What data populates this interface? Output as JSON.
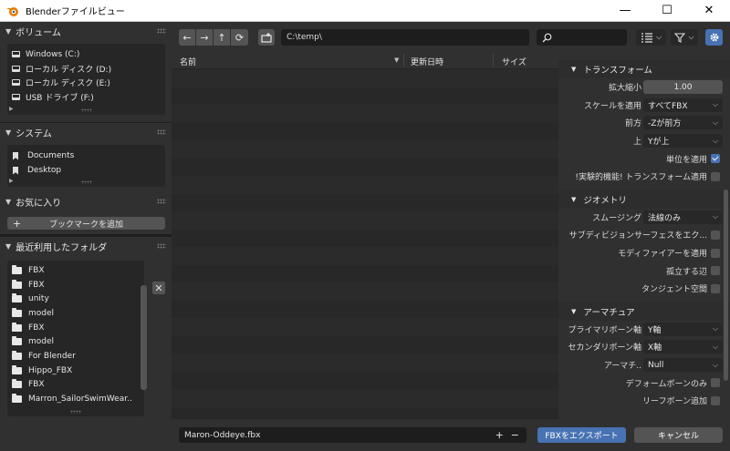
{
  "window": {
    "title": "Blenderファイルビュー",
    "minimize": "—",
    "maximize": "☐",
    "close": "✕"
  },
  "sidebar": {
    "volumes": {
      "title": "ボリューム",
      "items": [
        "Windows (C:)",
        "ローカル ディスク (D:)",
        "ローカル ディスク (E:)",
        "USB ドライブ (F:)"
      ]
    },
    "system": {
      "title": "システム",
      "items": [
        "Documents",
        "Desktop"
      ]
    },
    "favorites": {
      "title": "お気に入り",
      "add_label": "ブックマークを追加"
    },
    "recent": {
      "title": "最近利用したフォルダ",
      "items": [
        "FBX",
        "FBX",
        "unity",
        "model",
        "FBX",
        "model",
        "For Blender",
        "Hippo_FBX",
        "FBX",
        "Marron_SailorSwimWear.."
      ]
    }
  },
  "toolbar": {
    "path": "C:\\temp\\",
    "back": "←",
    "forward": "→",
    "parent": "↑",
    "refresh": "⟳"
  },
  "filelist": {
    "columns": {
      "name": "名前",
      "modified": "更新日時",
      "size": "サイズ"
    }
  },
  "properties": {
    "transform": {
      "title": "トランスフォーム",
      "scale_label": "拡大縮小",
      "scale_value": "1.00",
      "apply_scale_label": "スケールを適用",
      "apply_scale_value": "すべてFBX",
      "forward_label": "前方",
      "forward_value": "-Zが前方",
      "up_label": "上",
      "up_value": "Yが上",
      "apply_unit_label": "単位を適用",
      "apply_unit_checked": true,
      "experimental_label": "!実験的機能! トランスフォーム適用",
      "experimental_checked": false
    },
    "geometry": {
      "title": "ジオメトリ",
      "smoothing_label": "スムージング",
      "smoothing_value": "法線のみ",
      "subdiv_label": "サブディビジョンサーフェスをエク...",
      "subdiv_checked": false,
      "modifiers_label": "モディファイアーを適用",
      "modifiers_checked": false,
      "loose_label": "孤立する辺",
      "loose_checked": false,
      "tangent_label": "タンジェント空間",
      "tangent_checked": false
    },
    "armature": {
      "title": "アーマチュア",
      "primary_label": "プライマリボーン軸",
      "primary_value": "Y軸",
      "secondary_label": "セカンダリボーン軸",
      "secondary_value": "X軸",
      "node_label": "アーマチ..",
      "node_value": "Null",
      "deform_label": "デフォームボーンのみ",
      "deform_checked": false,
      "leaf_label": "リーフボーン追加",
      "leaf_checked": false
    }
  },
  "bottom": {
    "filename": "Maron-Oddeye.fbx",
    "export_label": "FBXをエクスポート",
    "cancel_label": "キャンセル"
  },
  "colors": {
    "accent": "#4772b3",
    "panel": "#303030",
    "field": "#1d1d1d"
  }
}
